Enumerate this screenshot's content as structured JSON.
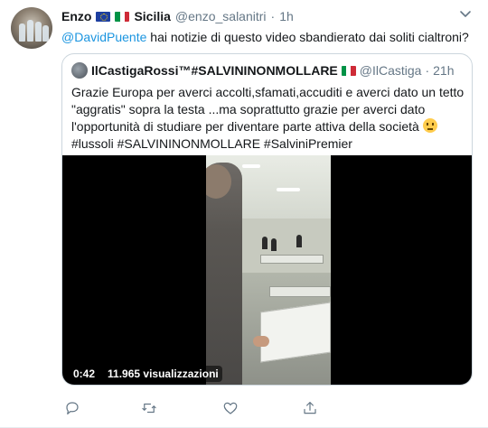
{
  "tweet": {
    "author_name": "Enzo",
    "author_location": "Sicilia",
    "author_handle": "@enzo_salanitri",
    "separator": "·",
    "time": "1h",
    "reply_mention": "@DavidPuente",
    "reply_text": " hai notizie di questo video sbandierato dai soliti cialtroni?"
  },
  "quote": {
    "author_name": "IlCastigaRossi™#SALVININONMOLLARE",
    "author_handle": "@IlCastiga",
    "separator": "·",
    "time": "21h",
    "text_line1": "Grazie Europa per averci accolti,sfamati,accuditi e averci dato un tetto",
    "text_line2": "\"aggratis\" sopra la testa ...ma soprattutto grazie per averci dato",
    "text_line3": "l'opportunità di studiare per diventare parte attiva della società ",
    "text_line4": " #lussoli  #SALVININONMOLLARE #SalviniPremier"
  },
  "video": {
    "duration": "0:42",
    "views": "11.965 visualizzazioni"
  },
  "actions": [
    "reply-icon",
    "retweet-icon",
    "like-icon",
    "share-icon"
  ],
  "colors": {
    "link": "#1b95e0",
    "secondary": "#657786",
    "border": "#ccd6dd",
    "eu_blue": "#1d3fa0",
    "italy_green": "#009246",
    "italy_red": "#ce2b37"
  }
}
